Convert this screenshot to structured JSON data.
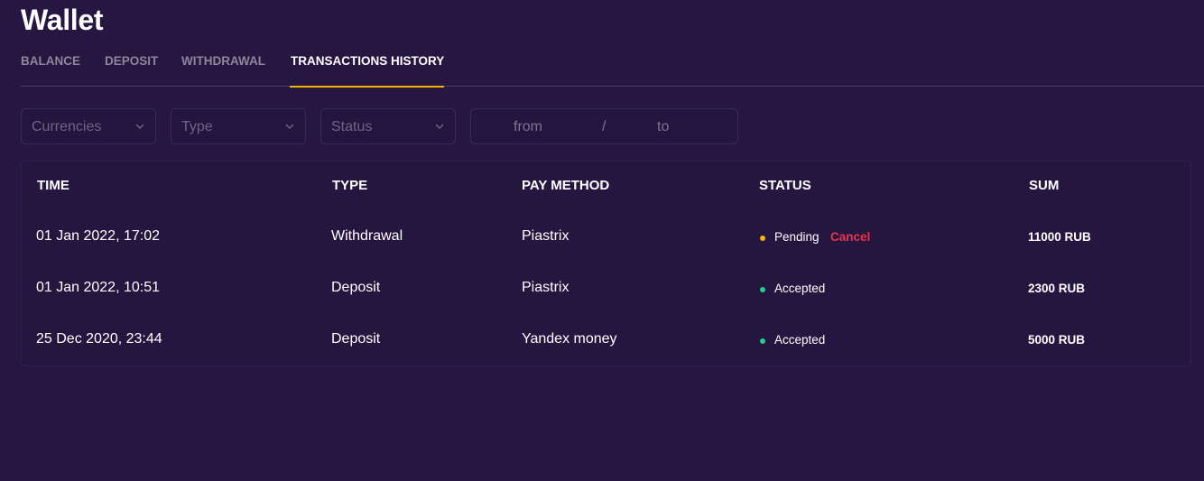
{
  "page": {
    "title": "Wallet"
  },
  "tabs": [
    {
      "label": "BALANCE",
      "active": false
    },
    {
      "label": "DEPOSIT",
      "active": false
    },
    {
      "label": "WITHDRAWAL",
      "active": false
    },
    {
      "label": "TRANSACTIONS HISTORY",
      "active": true
    }
  ],
  "filters": {
    "currencies": "Currencies",
    "type": "Type",
    "status": "Status",
    "date_from": "from",
    "date_separator": "/",
    "date_to": "to"
  },
  "table": {
    "headers": [
      "TIME",
      "TYPE",
      "PAY METHOD",
      "STATUS",
      "SUM"
    ],
    "rows": [
      {
        "time": "01 Jan 2022, 17:02",
        "type": "Withdrawal",
        "method": "Piastrix",
        "status": "Pending",
        "status_color": "#f5b400",
        "action": "Cancel",
        "sum": "11000 RUB"
      },
      {
        "time": "01 Jan 2022, 10:51",
        "type": "Deposit",
        "method": "Piastrix",
        "status": "Accepted",
        "status_color": "#1fd18a",
        "action": "",
        "sum": "2300 RUB"
      },
      {
        "time": "25 Dec 2020, 23:44",
        "type": "Deposit",
        "method": "Yandex money",
        "status": "Accepted",
        "status_color": "#1fd18a",
        "action": "",
        "sum": "5000 RUB"
      }
    ]
  },
  "colors": {
    "background": "#261641",
    "accent": "#f5b400",
    "danger": "#e8334a",
    "success": "#1fd18a"
  },
  "icons": {
    "dropdown": "chevron-down-icon",
    "status": "status-dot-icon"
  }
}
